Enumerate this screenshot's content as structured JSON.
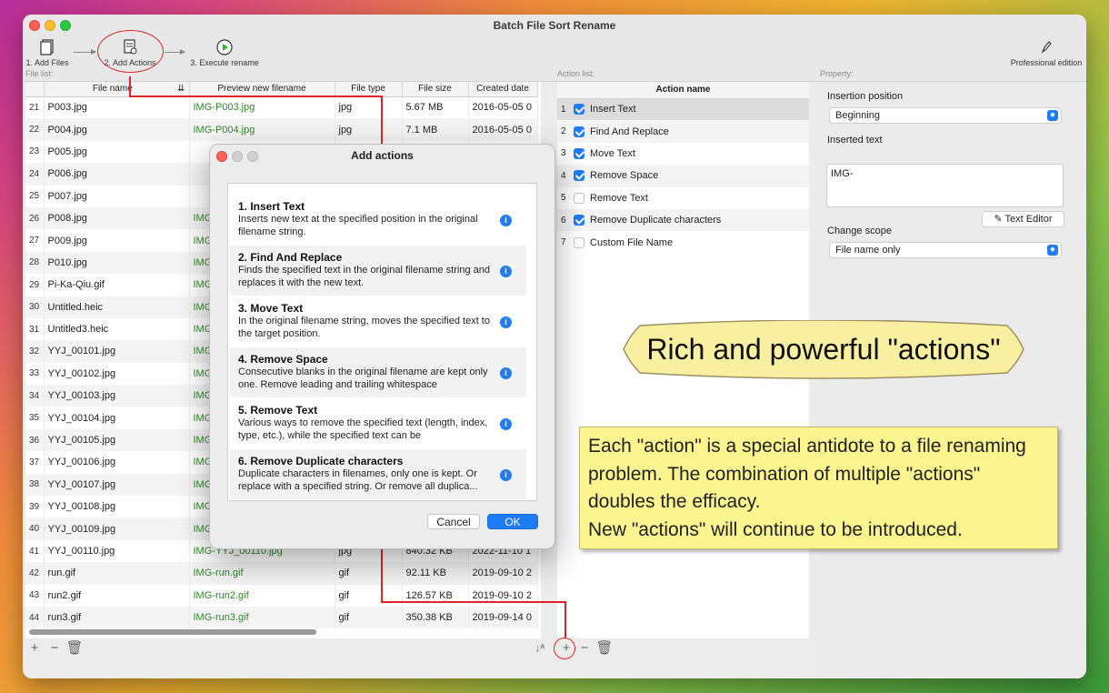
{
  "window": {
    "title": "Batch File Sort Rename"
  },
  "toolbar": {
    "add_files": "1. Add Files",
    "add_actions": "2. Add Actions",
    "execute": "3. Execute rename",
    "professional": "Professional edition"
  },
  "file_list": {
    "label": "File list:",
    "columns": [
      "File name",
      "Preview new filename",
      "File type",
      "File size",
      "Created date"
    ],
    "rows": [
      [
        "21",
        "P003.jpg",
        "IMG-P003.jpg",
        "jpg",
        "5.67 MB",
        "2016-05-05 0"
      ],
      [
        "22",
        "P004.jpg",
        "IMG-P004.jpg",
        "jpg",
        "7.1 MB",
        "2016-05-05 0"
      ],
      [
        "23",
        "P005.jpg",
        "",
        "",
        "",
        ""
      ],
      [
        "24",
        "P006.jpg",
        "",
        "",
        "",
        ""
      ],
      [
        "25",
        "P007.jpg",
        "",
        "",
        "",
        ""
      ],
      [
        "26",
        "P008.jpg",
        "IMG",
        "",
        "",
        ""
      ],
      [
        "27",
        "P009.jpg",
        "IMG",
        "",
        "",
        ""
      ],
      [
        "28",
        "P010.jpg",
        "IMG",
        "",
        "",
        ""
      ],
      [
        "29",
        "Pi-Ka-Qiu.gif",
        "IMG",
        "",
        "",
        ""
      ],
      [
        "30",
        "Untitled.heic",
        "IMG",
        "",
        "",
        ""
      ],
      [
        "31",
        "Untitled3.heic",
        "IMG",
        "",
        "",
        ""
      ],
      [
        "32",
        "YYJ_00101.jpg",
        "IMG",
        "",
        "",
        ""
      ],
      [
        "33",
        "YYJ_00102.jpg",
        "IMG",
        "",
        "",
        ""
      ],
      [
        "34",
        "YYJ_00103.jpg",
        "IMG",
        "",
        "",
        ""
      ],
      [
        "35",
        "YYJ_00104.jpg",
        "IMG",
        "",
        "",
        ""
      ],
      [
        "36",
        "YYJ_00105.jpg",
        "IMG",
        "",
        "",
        ""
      ],
      [
        "37",
        "YYJ_00106.jpg",
        "IMG",
        "",
        "",
        ""
      ],
      [
        "38",
        "YYJ_00107.jpg",
        "IMG",
        "",
        "",
        ""
      ],
      [
        "39",
        "YYJ_00108.jpg",
        "IMG",
        "",
        "",
        ""
      ],
      [
        "40",
        "YYJ_00109.jpg",
        "IMG",
        "",
        "",
        ""
      ],
      [
        "41",
        "YYJ_00110.jpg",
        "IMG-YYJ_00110.jpg",
        "jpg",
        "840.32 KB",
        "2022-11-10 1"
      ],
      [
        "42",
        "run.gif",
        "IMG-run.gif",
        "gif",
        "92.11 KB",
        "2019-09-10 2"
      ],
      [
        "43",
        "run2.gif",
        "IMG-run2.gif",
        "gif",
        "126.57 KB",
        "2019-09-10 2"
      ],
      [
        "44",
        "run3.gif",
        "IMG-run3.gif",
        "gif",
        "350.38 KB",
        "2019-09-14 0"
      ]
    ]
  },
  "action_list": {
    "label": "Action list:",
    "header": "Action name",
    "items": [
      {
        "num": "1",
        "name": "Insert Text",
        "checked": true
      },
      {
        "num": "2",
        "name": "Find And Replace",
        "checked": true
      },
      {
        "num": "3",
        "name": "Move Text",
        "checked": true
      },
      {
        "num": "4",
        "name": "Remove Space",
        "checked": true
      },
      {
        "num": "5",
        "name": "Remove Text",
        "checked": false
      },
      {
        "num": "6",
        "name": "Remove Duplicate characters",
        "checked": true
      },
      {
        "num": "7",
        "name": "Custom File Name",
        "checked": false
      }
    ]
  },
  "property": {
    "label": "Property:",
    "insertion_position_label": "Insertion position",
    "insertion_position_value": "Beginning",
    "inserted_text_label": "Inserted text",
    "inserted_text_value": "IMG-",
    "text_editor_button": "Text Editor",
    "change_scope_label": "Change scope",
    "change_scope_value": "File name only"
  },
  "dialog": {
    "title": "Add actions",
    "items": [
      {
        "title": "1. Insert Text",
        "desc": "Inserts new text at the specified position in the original filename string."
      },
      {
        "title": "2. Find And Replace",
        "desc": "Finds the specified text in the original filename string and replaces it with the new text."
      },
      {
        "title": "3. Move Text",
        "desc": "In the original filename string, moves the specified text to the target position."
      },
      {
        "title": "4. Remove Space",
        "desc": "Consecutive blanks in the original filename are kept only one. Remove leading and trailing whitespace"
      },
      {
        "title": "5. Remove Text",
        "desc": "Various ways to remove the specified text (length, index, type, etc.), while the specified text can be"
      },
      {
        "title": "6. Remove Duplicate characters",
        "desc": "Duplicate characters in filenames, only one is kept. Or replace with a specified string. Or remove all duplica..."
      }
    ],
    "cancel": "Cancel",
    "ok": "OK"
  },
  "promo": {
    "banner": "Rich and powerful \"actions\"",
    "note_lines": [
      "Each \"action\" is a special antidote to a file renaming",
      "problem. The combination of multiple \"actions\"",
      "doubles the efficacy.",
      "New \"actions\" will continue to be introduced."
    ]
  },
  "colors": {
    "accent": "#1f7cf5",
    "preview_green": "#2a8a22",
    "annotation_red": "#e0252a",
    "note_yellow": "#fcf48f",
    "banner_yellow": "#f8f0a0"
  }
}
